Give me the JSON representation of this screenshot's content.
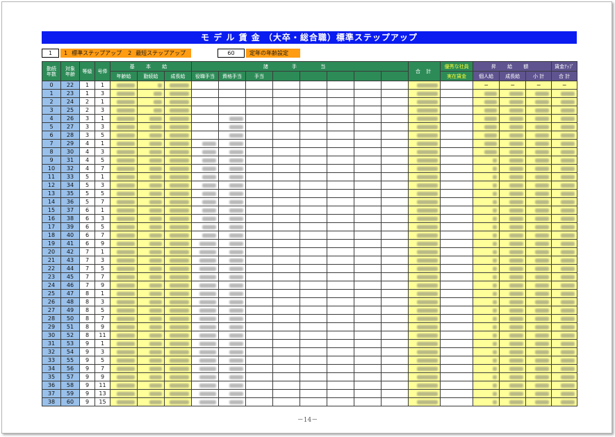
{
  "page": {
    "title": "モ デ ル 賃 金 （大卒・総合職）標準ステップアップ",
    "page_number": "－14－"
  },
  "settings": {
    "mode_value": "1",
    "mode_options": [
      {
        "num": "1",
        "label": "標準ステップアップ"
      },
      {
        "num": "2",
        "label": "最短ステップアップ"
      }
    ],
    "retirement_age_value": "60",
    "retirement_age_label": "定年の年齢設定"
  },
  "headers": {
    "years": [
      "勤続",
      "年数"
    ],
    "age": [
      "対象",
      "年齢"
    ],
    "grade": "等級",
    "step": "号俸",
    "base_pay": "基 本 給",
    "age_pay": "年齢給",
    "tenure_pay": "勤続給",
    "growth_pay": "成長給",
    "allowances": "諸 手 当",
    "position_allow": "役職手当",
    "qualification_allow": "資格手当",
    "other_allow": "手当",
    "total": "合 計",
    "excellent_top": "優秀な社員",
    "excellent_bottom": "実在賃金",
    "raise": "昇 給 額",
    "raise_personal": "個人給",
    "raise_growth": "成長給",
    "raise_subtotal": "小 計",
    "wage_up_top": "賃金ｱｯﾌﾟ",
    "wage_up_bottom": "合 計"
  },
  "obscured_rows": {
    "age_pay": [
      0,
      38
    ],
    "tenure_pay": [
      0,
      38
    ],
    "growth_pay": [
      0,
      38
    ],
    "position_allow": [
      7,
      38
    ],
    "qualification_allow": [
      4,
      38
    ],
    "total": [
      0,
      38
    ],
    "raise_personal": [
      1,
      38
    ],
    "raise_growth": [
      1,
      38
    ],
    "raise_subtotal": [
      1,
      38
    ],
    "wage_up_total": [
      1,
      38
    ]
  },
  "rows": [
    {
      "years": "0",
      "age": "22",
      "grade": "1",
      "step": "1",
      "raise_personal": "−",
      "raise_growth": "−",
      "raise_subtotal": "−",
      "wage_up_total": "−"
    },
    {
      "years": "1",
      "age": "23",
      "grade": "1",
      "step": "3"
    },
    {
      "years": "2",
      "age": "24",
      "grade": "2",
      "step": "1"
    },
    {
      "years": "3",
      "age": "25",
      "grade": "2",
      "step": "3"
    },
    {
      "years": "4",
      "age": "26",
      "grade": "3",
      "step": "1"
    },
    {
      "years": "5",
      "age": "27",
      "grade": "3",
      "step": "3"
    },
    {
      "years": "6",
      "age": "28",
      "grade": "3",
      "step": "5"
    },
    {
      "years": "7",
      "age": "29",
      "grade": "4",
      "step": "1"
    },
    {
      "years": "8",
      "age": "30",
      "grade": "4",
      "step": "3"
    },
    {
      "years": "9",
      "age": "31",
      "grade": "4",
      "step": "5"
    },
    {
      "years": "10",
      "age": "32",
      "grade": "4",
      "step": "7"
    },
    {
      "years": "11",
      "age": "33",
      "grade": "5",
      "step": "1"
    },
    {
      "years": "12",
      "age": "34",
      "grade": "5",
      "step": "3"
    },
    {
      "years": "13",
      "age": "35",
      "grade": "5",
      "step": "5"
    },
    {
      "years": "14",
      "age": "36",
      "grade": "5",
      "step": "7"
    },
    {
      "years": "15",
      "age": "37",
      "grade": "6",
      "step": "1"
    },
    {
      "years": "16",
      "age": "38",
      "grade": "6",
      "step": "3"
    },
    {
      "years": "17",
      "age": "39",
      "grade": "6",
      "step": "5"
    },
    {
      "years": "18",
      "age": "40",
      "grade": "6",
      "step": "7"
    },
    {
      "years": "19",
      "age": "41",
      "grade": "6",
      "step": "9"
    },
    {
      "years": "20",
      "age": "42",
      "grade": "7",
      "step": "1"
    },
    {
      "years": "21",
      "age": "43",
      "grade": "7",
      "step": "3"
    },
    {
      "years": "22",
      "age": "44",
      "grade": "7",
      "step": "5"
    },
    {
      "years": "23",
      "age": "45",
      "grade": "7",
      "step": "7"
    },
    {
      "years": "24",
      "age": "46",
      "grade": "7",
      "step": "9"
    },
    {
      "years": "25",
      "age": "47",
      "grade": "8",
      "step": "1"
    },
    {
      "years": "26",
      "age": "48",
      "grade": "8",
      "step": "3"
    },
    {
      "years": "27",
      "age": "49",
      "grade": "8",
      "step": "5"
    },
    {
      "years": "28",
      "age": "50",
      "grade": "8",
      "step": "7"
    },
    {
      "years": "29",
      "age": "51",
      "grade": "8",
      "step": "9"
    },
    {
      "years": "30",
      "age": "52",
      "grade": "8",
      "step": "11"
    },
    {
      "years": "31",
      "age": "53",
      "grade": "9",
      "step": "1"
    },
    {
      "years": "32",
      "age": "54",
      "grade": "9",
      "step": "3"
    },
    {
      "years": "33",
      "age": "55",
      "grade": "9",
      "step": "5"
    },
    {
      "years": "34",
      "age": "56",
      "grade": "9",
      "step": "7"
    },
    {
      "years": "35",
      "age": "57",
      "grade": "9",
      "step": "9"
    },
    {
      "years": "36",
      "age": "58",
      "grade": "9",
      "step": "11"
    },
    {
      "years": "37",
      "age": "59",
      "grade": "9",
      "step": "13"
    },
    {
      "years": "38",
      "age": "60",
      "grade": "9",
      "step": "15"
    }
  ]
}
